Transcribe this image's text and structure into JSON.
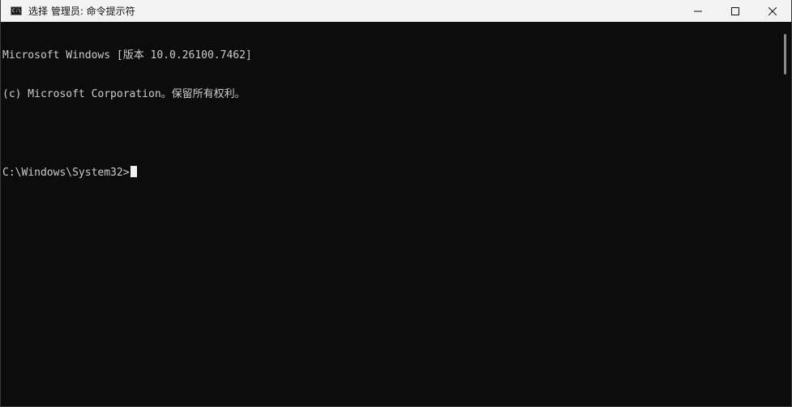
{
  "window": {
    "title": "选择 管理员: 命令提示符",
    "icon_glyph": "C:\\."
  },
  "controls": {
    "minimize": "minimize-icon",
    "maximize": "maximize-icon",
    "close": "close-icon"
  },
  "console": {
    "lines": [
      "Microsoft Windows [版本 10.0.26100.7462]",
      "(c) Microsoft Corporation。保留所有权利。",
      "",
      "C:\\Windows\\System32>"
    ]
  },
  "colors": {
    "background": "#0c0c0c",
    "text": "#cccccc",
    "titlebar": "#f3f3f3"
  }
}
